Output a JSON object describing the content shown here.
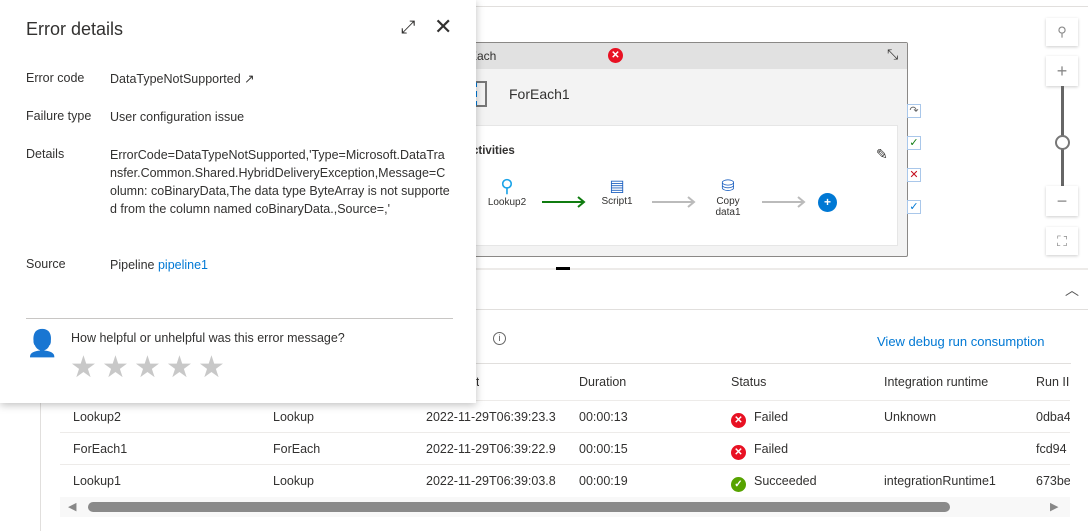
{
  "panel": {
    "title": "Error details",
    "fields": [
      {
        "label": "Error code",
        "value": "DataTypeNotSupported"
      },
      {
        "label": "Failure type",
        "value": "User configuration issue"
      },
      {
        "label": "Details",
        "value": "ErrorCode=DataTypeNotSupported,'Type=Microsoft.DataTransfer.Common.Shared.HybridDeliveryException,Message=Column: coBinaryData,The data type ByteArray is not supported from the column named coBinaryData.,Source=,'"
      },
      {
        "label": "Source",
        "prefix": "Pipeline",
        "value": "pipeline1"
      }
    ],
    "feedback_question": "How helpful or unhelpful was this error message?",
    "rating": 0,
    "max_rating": 5
  },
  "foreach": {
    "header": "rEach",
    "name": "ForEach1",
    "activities_label": "ctivities",
    "activities": [
      "Lookup2",
      "Script1",
      "Copy data1"
    ]
  },
  "debug_link": "View debug run consumption",
  "table": {
    "columns": [
      "t",
      "Duration",
      "Status",
      "Integration runtime",
      "Run II"
    ],
    "rows": [
      {
        "name": "Lookup2",
        "type": "Lookup",
        "start": "2022-11-29T06:39:23.3",
        "duration": "00:00:13",
        "status": "Failed",
        "ir": "Unknown",
        "runid": "0dba4"
      },
      {
        "name": "ForEach1",
        "type": "ForEach",
        "start": "2022-11-29T06:39:22.9",
        "duration": "00:00:15",
        "status": "Failed",
        "ir": "",
        "runid": "fcd94"
      },
      {
        "name": "Lookup1",
        "type": "Lookup",
        "start": "2022-11-29T06:39:03.8",
        "duration": "00:00:19",
        "status": "Succeeded",
        "ir": "integrationRuntime1",
        "runid": "673be"
      }
    ]
  },
  "colors": {
    "accent": "#0078d4",
    "failed": "#e81123",
    "succeeded": "#57a300",
    "success_arrow": "#107c10"
  }
}
